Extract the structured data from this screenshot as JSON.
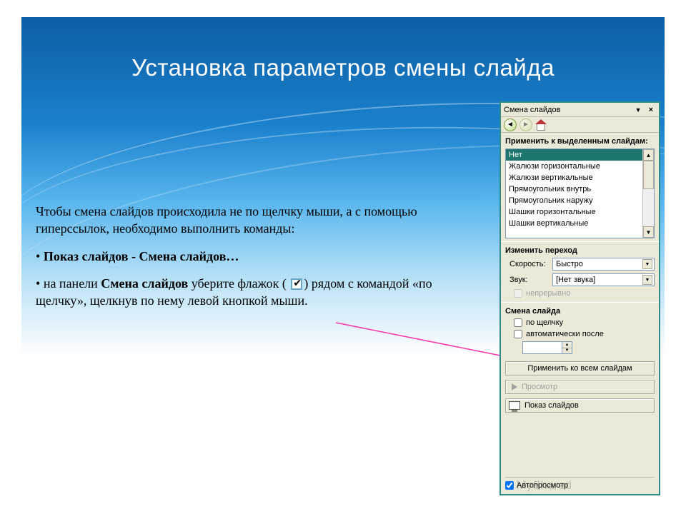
{
  "title": "Установка параметров смены слайда",
  "body": {
    "intro": "Чтобы смена слайдов происходила не по щелчку мыши, а с помощью гиперссылок, необходимо выполнить команды:",
    "bullet1": "Показ слайдов - Смена слайдов…",
    "bullet2_a": "на панели ",
    "bullet2_b": "Смена слайдов",
    "bullet2_c": " уберите флажок ( ",
    "bullet2_d": " рядом с командой «по щелчку», щелкнув по нему левой кнопкой мыши."
  },
  "panel": {
    "title": "Смена слайдов",
    "apply_label": "Применить к выделенным слайдам:",
    "transitions": [
      "Нет",
      "Жалюзи горизонтальные",
      "Жалюзи вертикальные",
      "Прямоугольник внутрь",
      "Прямоугольник наружу",
      "Шашки горизонтальные",
      "Шашки вертикальные"
    ],
    "section_modify": "Изменить переход",
    "speed_label": "Скорость:",
    "speed_value": "Быстро",
    "sound_label": "Звук:",
    "sound_value": "[Нет звука]",
    "loop_label": "непрерывно",
    "section_advance": "Смена слайда",
    "on_click": "по щелчку",
    "auto_after": "автоматически после",
    "apply_all": "Применить ко всем слайдам",
    "play": "Просмотр",
    "slideshow": "Показ слайдов",
    "auto_preview": "Автопросмотр"
  },
  "watermark": "MyShared"
}
